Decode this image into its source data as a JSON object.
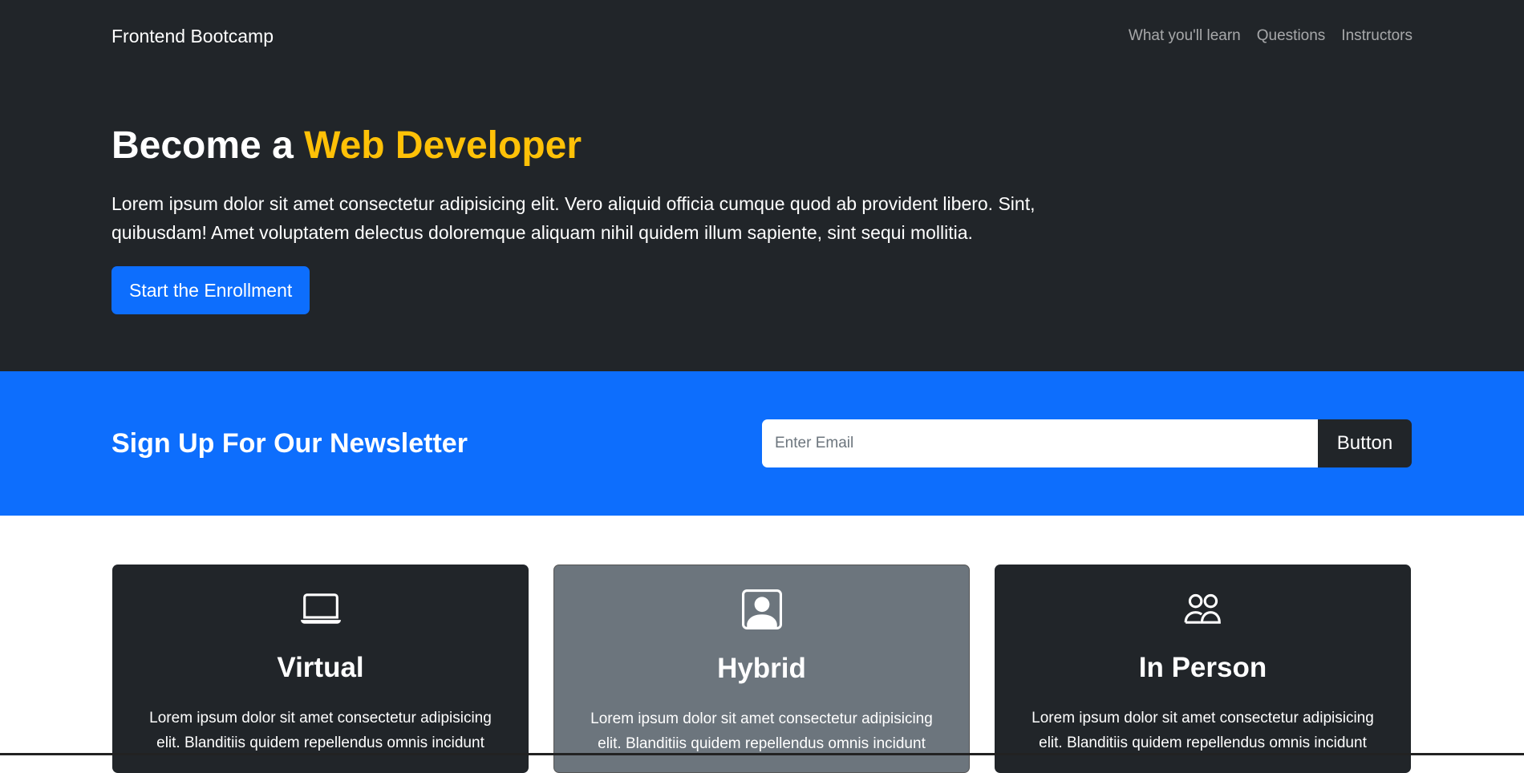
{
  "navbar": {
    "brand": "Frontend Bootcamp",
    "links": [
      "What you'll learn",
      "Questions",
      "Instructors"
    ]
  },
  "hero": {
    "title_prefix": "Become a ",
    "title_accent": "Web Developer",
    "lead": "Lorem ipsum dolor sit amet consectetur adipisicing elit. Vero aliquid officia cumque quod ab provident libero. Sint, quibusdam! Amet voluptatem delectus doloremque aliquam nihil quidem illum sapiente, sint sequi mollitia.",
    "button": "Start the Enrollment"
  },
  "newsletter": {
    "title": "Sign Up For Our Newsletter",
    "placeholder": "Enter Email",
    "button": "Button"
  },
  "cards": [
    {
      "icon": "laptop-icon",
      "title": "Virtual",
      "text": "Lorem ipsum dolor sit amet consectetur adipisicing elit. Blanditiis quidem repellendus omnis incidunt"
    },
    {
      "icon": "person-square-icon",
      "title": "Hybrid",
      "text": "Lorem ipsum dolor sit amet consectetur adipisicing elit. Blanditiis quidem repellendus omnis incidunt"
    },
    {
      "icon": "people-icon",
      "title": "In Person",
      "text": "Lorem ipsum dolor sit amet consectetur adipisicing elit. Blanditiis quidem repellendus omnis incidunt"
    }
  ],
  "colors": {
    "dark": "#212529",
    "primary": "#0d6efd",
    "accent": "#ffc107",
    "secondary": "#6c757d"
  }
}
